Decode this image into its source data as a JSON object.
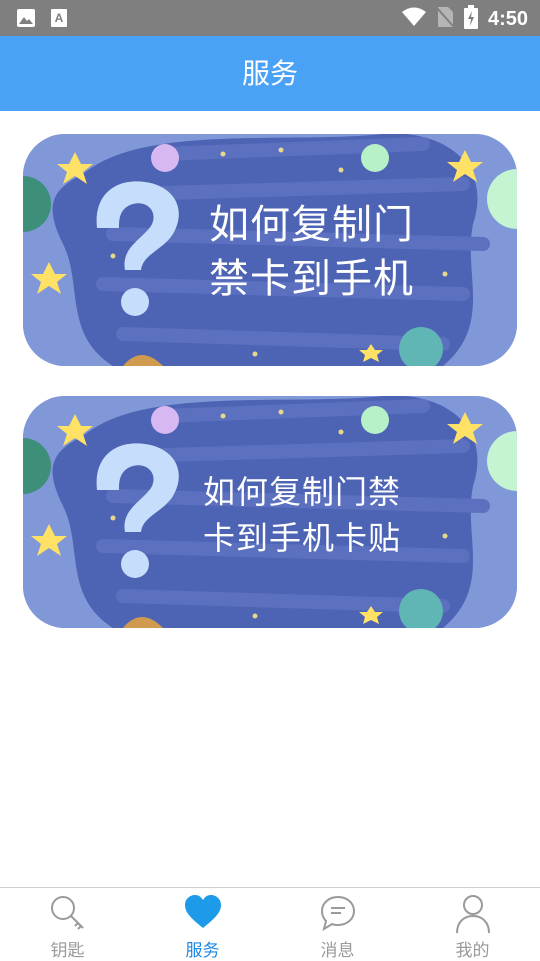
{
  "status_bar": {
    "time": "4:50",
    "icons": [
      "image-icon",
      "font-icon",
      "wifi-icon",
      "no-sim-icon",
      "battery-charging-icon"
    ]
  },
  "header": {
    "title": "服务",
    "background": "#49a2f6"
  },
  "banners": [
    {
      "lines": [
        "如何复制门",
        "禁卡到手机"
      ]
    },
    {
      "lines": [
        "如何复制门禁",
        "卡到手机卡贴"
      ]
    }
  ],
  "tabs": [
    {
      "label": "钥匙",
      "icon": "search-key-icon",
      "active": false
    },
    {
      "label": "服务",
      "icon": "heart-icon",
      "active": true
    },
    {
      "label": "消息",
      "icon": "chat-bubble-icon",
      "active": false
    },
    {
      "label": "我的",
      "icon": "person-icon",
      "active": false
    }
  ],
  "colors": {
    "active_tab": "#1e88e5",
    "inactive_tab": "#9a9a9a",
    "banner_bg": "#8097d8",
    "banner_stroke": "#4d63b4"
  }
}
